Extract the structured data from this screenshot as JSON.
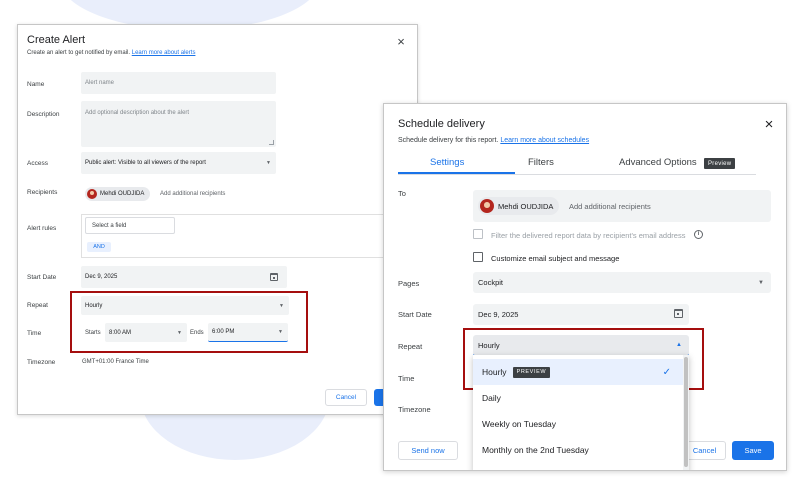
{
  "create_alert": {
    "title": "Create Alert",
    "subtitle": "Create an alert to get notified by email.",
    "learn_more": "Learn more about alerts",
    "labels": {
      "name": "Name",
      "description": "Description",
      "access": "Access",
      "recipients": "Recipients",
      "alert_rules": "Alert rules",
      "start_date": "Start Date",
      "repeat": "Repeat",
      "time": "Time",
      "timezone": "Timezone"
    },
    "name_placeholder": "Alert name",
    "description_placeholder": "Add optional description about the alert",
    "access_value": "Public alert: Visible to all viewers of the report",
    "recipient": "Mehdi OUDJIDA",
    "add_recipients": "Add additional recipients",
    "field_select": "Select a field",
    "and_label": "AND",
    "start_date_value": "Dec 9, 2025",
    "repeat_value": "Hourly",
    "starts_label": "Starts",
    "starts_value": "8:00 AM",
    "ends_label": "Ends",
    "ends_value": "6:00 PM",
    "timezone_value": "GMT+01:00 France Time",
    "cancel": "Cancel"
  },
  "schedule_delivery": {
    "title": "Schedule delivery",
    "subtitle": "Schedule delivery for this report.",
    "learn_more": "Learn more about schedules",
    "tabs": [
      "Settings",
      "Filters",
      "Advanced Options"
    ],
    "preview_badge": "Preview",
    "labels": {
      "to": "To",
      "pages": "Pages",
      "start_date": "Start Date",
      "repeat": "Repeat",
      "time": "Time",
      "timezone": "Timezone"
    },
    "recipient": "Mehdi OUDJIDA",
    "add_recipients": "Add additional recipients",
    "filter_checkbox": "Filter the delivered report data by recipient's email address",
    "customize_checkbox": "Customize email subject and message",
    "pages_value": "Cockpit",
    "start_date_value": "Dec 9, 2025",
    "repeat_value": "Hourly",
    "menu_items": [
      "Hourly",
      "Daily",
      "Weekly on Tuesday",
      "Monthly on the 2nd Tuesday"
    ],
    "menu_badge": "PREVIEW",
    "send_now": "Send now",
    "cancel": "Cancel",
    "save": "Save"
  },
  "colors": {
    "accent": "#1a73e8",
    "highlight_border": "#a50e0e",
    "avatar": "#b3261e"
  },
  "icons": [
    "close-icon",
    "calendar-icon",
    "caret-down-icon",
    "caret-up-icon",
    "check-icon",
    "info-icon",
    "avatar"
  ]
}
